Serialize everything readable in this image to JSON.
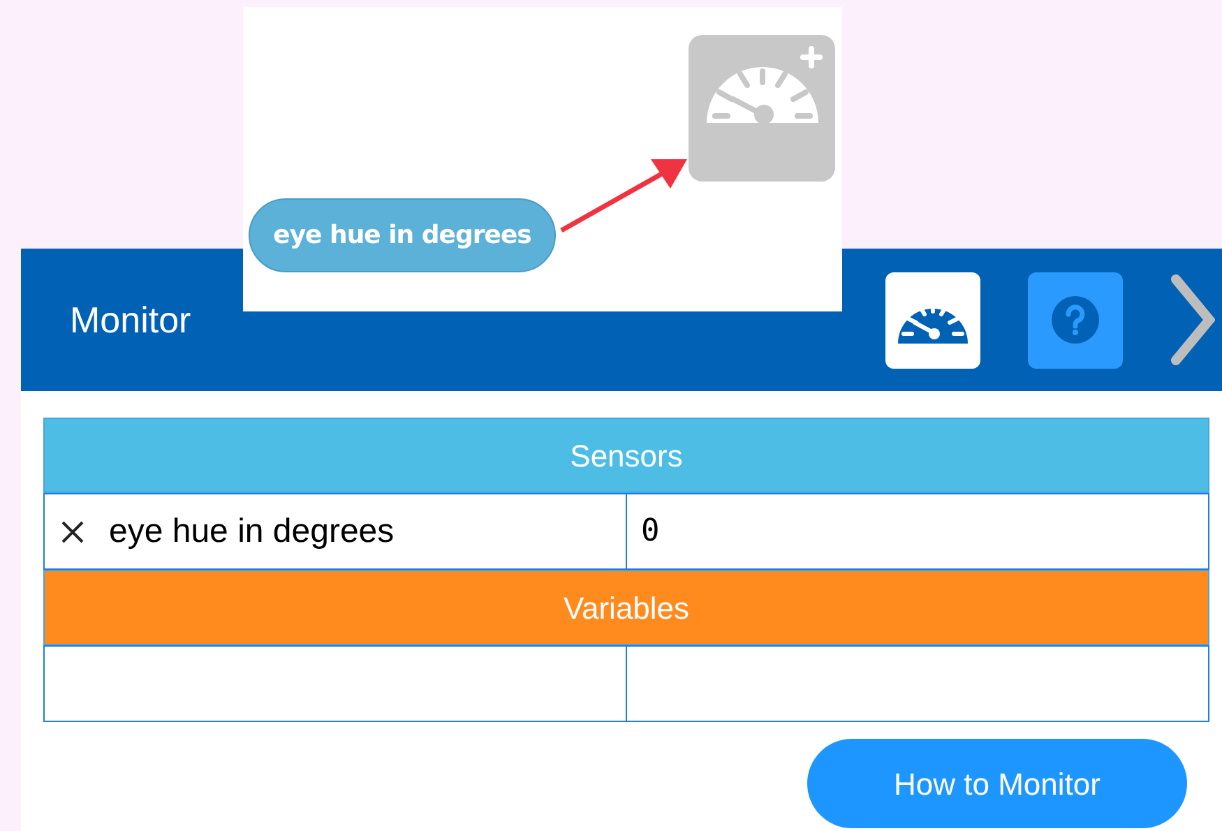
{
  "callout": {
    "label": "eye hue in degrees"
  },
  "header": {
    "title": "Monitor"
  },
  "sections": [
    {
      "kind": "sensors",
      "title": "Sensors",
      "rows": [
        {
          "name": "eye hue in degrees",
          "value": "0"
        }
      ]
    },
    {
      "kind": "variables",
      "title": "Variables"
    }
  ],
  "button": "How to Monitor"
}
